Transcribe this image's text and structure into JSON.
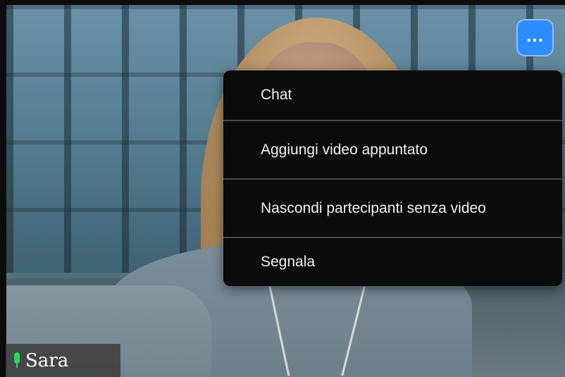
{
  "participant": {
    "name": "Sara",
    "mic_state": "active"
  },
  "more_button": {
    "label": "..."
  },
  "menu": {
    "items": [
      {
        "label": "Chat"
      },
      {
        "label": "Aggiungi video appuntato"
      },
      {
        "label": "Nascondi partecipanti senza video"
      },
      {
        "label": "Segnala"
      }
    ]
  },
  "colors": {
    "accent": "#2d8cff",
    "mic_active": "#23d959",
    "menu_bg": "#0b0b0c"
  }
}
